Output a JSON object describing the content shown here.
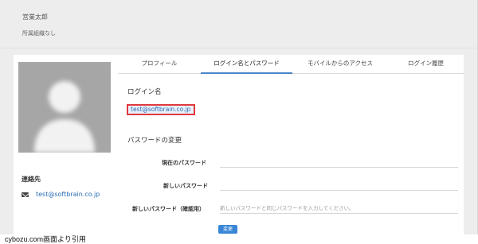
{
  "user": {
    "name": "営業太郎",
    "organization": "所属組織なし"
  },
  "tabs": [
    {
      "label": "プロフィール",
      "active": false
    },
    {
      "label": "ログイン名とパスワード",
      "active": true
    },
    {
      "label": "モバイルからのアクセス",
      "active": false
    },
    {
      "label": "ログイン履歴",
      "active": false
    }
  ],
  "login": {
    "section_title": "ログイン名",
    "login_id": "test@softbrain.co.jp"
  },
  "password": {
    "section_title": "パスワードの変更",
    "current_label": "現在のパスワード",
    "new_label": "新しいパスワード",
    "confirm_label": "新しいパスワード（確認用）",
    "confirm_placeholder": "新しいパスワードと同じパスワードを入力してください。",
    "change_button": "変更"
  },
  "contact": {
    "title": "連絡先",
    "email": "test@softbrain.co.jp",
    "icon": "mail-icon"
  },
  "caption": "cybozu.com画面より引用",
  "colors": {
    "accent": "#3a86d6",
    "highlight_border": "#e0393e",
    "link": "#2a6db5"
  }
}
